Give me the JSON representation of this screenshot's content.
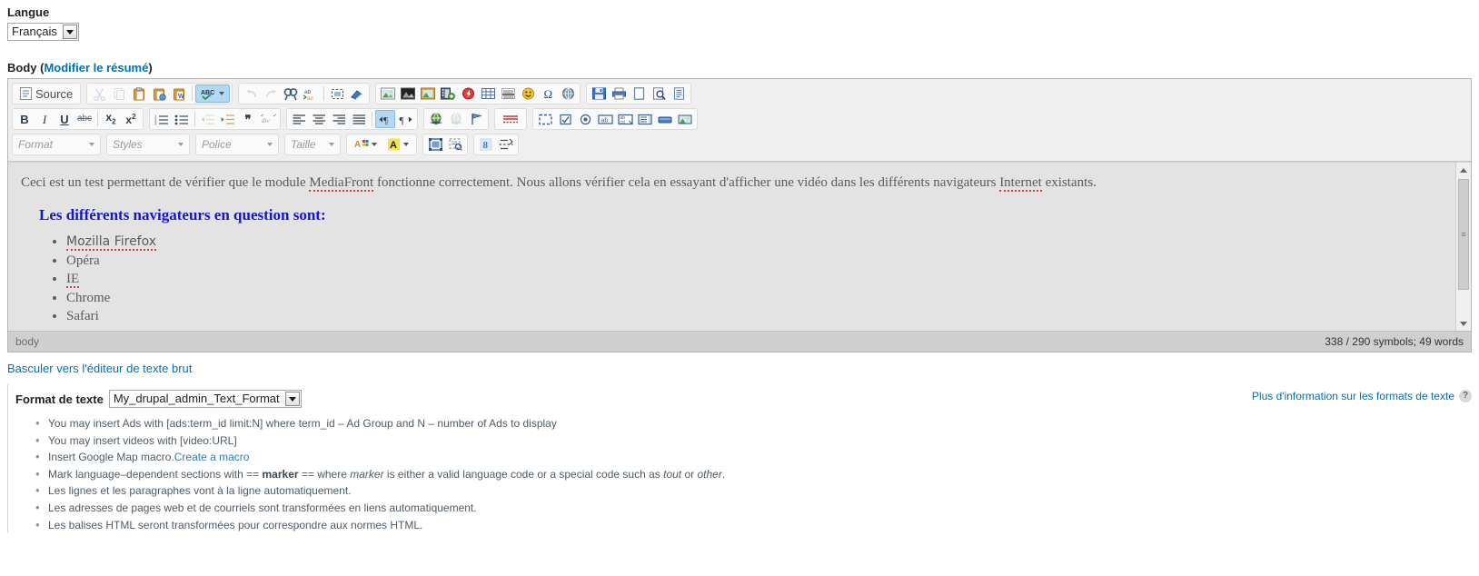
{
  "language_field": {
    "label": "Langue",
    "selected": "Français"
  },
  "body_field": {
    "label_prefix": "Body (",
    "summary_link": "Modifier le résumé",
    "label_suffix": ")"
  },
  "editor": {
    "toolbar_row1": {
      "source_label": "Source",
      "buttons": [
        {
          "name": "cut-icon",
          "glyph": "✂",
          "state": "disabled"
        },
        {
          "name": "copy-icon",
          "glyph": "❐",
          "state": "disabled"
        },
        {
          "name": "paste-icon",
          "glyph": "📋",
          "state": "normal"
        },
        {
          "name": "paste-as-plain-text-icon",
          "glyph": "📄",
          "state": "normal"
        },
        {
          "name": "paste-from-word-icon",
          "glyph": "W",
          "state": "normal"
        },
        {
          "name": "spell-check-icon",
          "glyph": "ABC",
          "state": "active"
        },
        {
          "name": "undo-icon",
          "glyph": "↶",
          "state": "disabled"
        },
        {
          "name": "redo-icon",
          "glyph": "↷",
          "state": "disabled"
        },
        {
          "name": "find-icon",
          "glyph": "🔍",
          "state": "normal"
        },
        {
          "name": "replace-icon",
          "glyph": "ab",
          "state": "normal"
        },
        {
          "name": "select-all-icon",
          "glyph": "⬚",
          "state": "normal"
        },
        {
          "name": "remove-format-icon",
          "glyph": "◆",
          "state": "normal"
        },
        {
          "name": "image-icon",
          "glyph": "🖼",
          "state": "normal"
        },
        {
          "name": "media-icon",
          "glyph": "🏞",
          "state": "normal"
        },
        {
          "name": "picture-frame-icon",
          "glyph": "▣",
          "state": "normal"
        },
        {
          "name": "add-video-icon",
          "glyph": "🎞",
          "state": "normal"
        },
        {
          "name": "flash-icon",
          "glyph": "ƒ",
          "state": "normal"
        },
        {
          "name": "table-icon",
          "glyph": "▦",
          "state": "normal"
        },
        {
          "name": "horizontal-rule-icon",
          "glyph": "▤",
          "state": "normal"
        },
        {
          "name": "smiley-icon",
          "glyph": "☺",
          "state": "normal"
        },
        {
          "name": "special-character-icon",
          "glyph": "Ω",
          "state": "normal"
        },
        {
          "name": "page-break-icon",
          "glyph": "◉",
          "state": "normal"
        },
        {
          "name": "save-icon",
          "glyph": "💾",
          "state": "normal"
        },
        {
          "name": "print-icon",
          "glyph": "🖨",
          "state": "normal"
        },
        {
          "name": "new-page-icon",
          "glyph": "▭",
          "state": "normal"
        },
        {
          "name": "preview-icon",
          "glyph": "🔎",
          "state": "normal"
        },
        {
          "name": "templates-icon",
          "glyph": "▤",
          "state": "normal"
        }
      ]
    },
    "toolbar_row2": {
      "buttons": [
        {
          "name": "bold-icon",
          "glyph": "B",
          "state": "normal"
        },
        {
          "name": "italic-icon",
          "glyph": "I",
          "state": "normal"
        },
        {
          "name": "underline-icon",
          "glyph": "U",
          "state": "normal"
        },
        {
          "name": "strikethrough-icon",
          "glyph": "abc",
          "state": "normal"
        },
        {
          "name": "subscript-icon",
          "glyph": "x₂",
          "state": "normal"
        },
        {
          "name": "superscript-icon",
          "glyph": "x²",
          "state": "normal"
        },
        {
          "name": "numbered-list-icon",
          "glyph": "1≡",
          "state": "normal"
        },
        {
          "name": "bulleted-list-icon",
          "glyph": "•≡",
          "state": "normal"
        },
        {
          "name": "decrease-indent-icon",
          "glyph": "⇤",
          "state": "disabled"
        },
        {
          "name": "increase-indent-icon",
          "glyph": "⇥",
          "state": "normal"
        },
        {
          "name": "blockquote-icon",
          "glyph": "❞",
          "state": "normal"
        },
        {
          "name": "create-div-icon",
          "glyph": "div",
          "state": "normal"
        },
        {
          "name": "align-left-icon",
          "glyph": "≡",
          "state": "normal"
        },
        {
          "name": "align-center-icon",
          "glyph": "≡",
          "state": "normal"
        },
        {
          "name": "align-right-icon",
          "glyph": "≡",
          "state": "normal"
        },
        {
          "name": "justify-icon",
          "glyph": "≡",
          "state": "normal"
        },
        {
          "name": "text-direction-ltr-icon",
          "glyph": "¶",
          "state": "active"
        },
        {
          "name": "text-direction-rtl-icon",
          "glyph": "¶",
          "state": "normal"
        },
        {
          "name": "link-icon",
          "glyph": "🌐",
          "state": "normal"
        },
        {
          "name": "unlink-icon",
          "glyph": "🌐",
          "state": "disabled"
        },
        {
          "name": "anchor-icon",
          "glyph": "⚑",
          "state": "normal"
        },
        {
          "name": "spell-underline-icon",
          "glyph": "≣",
          "state": "normal"
        },
        {
          "name": "show-blocks-icon",
          "glyph": "⬚",
          "state": "normal"
        },
        {
          "name": "checkbox-icon",
          "glyph": "☑",
          "state": "normal"
        },
        {
          "name": "radio-button-icon",
          "glyph": "◉",
          "state": "normal"
        },
        {
          "name": "text-field-icon",
          "glyph": "ab",
          "state": "normal"
        },
        {
          "name": "textarea-icon",
          "glyph": "abcd",
          "state": "normal"
        },
        {
          "name": "selection-field-icon",
          "glyph": "▤",
          "state": "normal"
        },
        {
          "name": "button-icon",
          "glyph": "▬",
          "state": "normal"
        },
        {
          "name": "image-button-icon",
          "glyph": "🖼",
          "state": "normal"
        }
      ]
    },
    "toolbar_row3": {
      "combos": [
        {
          "name": "format-combo",
          "label": "Format"
        },
        {
          "name": "styles-combo",
          "label": "Styles"
        },
        {
          "name": "font-combo",
          "label": "Police"
        },
        {
          "name": "size-combo",
          "label": "Taille"
        }
      ],
      "buttons": [
        {
          "name": "text-color-icon",
          "glyph": "A",
          "state": "normal"
        },
        {
          "name": "background-color-icon",
          "glyph": "A",
          "state": "normal"
        },
        {
          "name": "maximize-icon",
          "glyph": "⛶",
          "state": "normal"
        },
        {
          "name": "show-blocks-icon",
          "glyph": "▣",
          "state": "normal"
        },
        {
          "name": "drupal-break-icon",
          "glyph": "8",
          "state": "normal"
        },
        {
          "name": "page-break-icon",
          "glyph": "⇹",
          "state": "normal"
        }
      ]
    },
    "document": {
      "paragraph_part1": "Ceci est un test permettant de vérifier que le module ",
      "paragraph_misspelled1": "MediaFront",
      "paragraph_part2": " fonctionne correctement. Nous allons vérifier cela en essayant d'afficher une vidéo dans les différents navigateurs ",
      "paragraph_misspelled2": "Internet",
      "paragraph_part3": " existants.",
      "heading": "Les différents navigateurs en question sont:",
      "list_items": [
        "Mozilla Firefox",
        "Opéra",
        "IE",
        "Chrome",
        "Safari"
      ]
    },
    "status": {
      "element_path": "body",
      "counter": "338 / 290 symbols; 49 words"
    }
  },
  "switch_editor_link": "Basculer vers l'éditeur de texte brut",
  "text_format": {
    "label": "Format de texte",
    "selected": "My_drupal_admin_Text_Format",
    "help_link": "Plus d'information sur les formats de texte",
    "help_icon": "?"
  },
  "format_tips": [
    {
      "parts": [
        {
          "t": "text",
          "v": "You may insert Ads with [ads:term_id limit:N] where term_id – Ad Group and N – number of Ads to display"
        }
      ]
    },
    {
      "parts": [
        {
          "t": "text",
          "v": "You may insert videos with [video:URL]"
        }
      ]
    },
    {
      "parts": [
        {
          "t": "text",
          "v": "Insert Google Map macro."
        },
        {
          "t": "link",
          "v": "Create a macro"
        }
      ]
    },
    {
      "parts": [
        {
          "t": "text",
          "v": "Mark language–dependent sections with == "
        },
        {
          "t": "bold",
          "v": "marker"
        },
        {
          "t": "text",
          "v": " == where "
        },
        {
          "t": "italic",
          "v": "marker"
        },
        {
          "t": "text",
          "v": " is either a valid language code or a special code such as "
        },
        {
          "t": "italic",
          "v": "tout"
        },
        {
          "t": "text",
          "v": " or "
        },
        {
          "t": "italic",
          "v": "other"
        },
        {
          "t": "text",
          "v": "."
        }
      ]
    },
    {
      "parts": [
        {
          "t": "text",
          "v": "Les lignes et les paragraphes vont à la ligne automatiquement."
        }
      ]
    },
    {
      "parts": [
        {
          "t": "text",
          "v": "Les adresses de pages web et de courriels sont transformées en liens automatiquement."
        }
      ]
    },
    {
      "parts": [
        {
          "t": "text",
          "v": "Les balises HTML seront transformées pour correspondre aux normes HTML."
        }
      ]
    }
  ],
  "colors": {
    "link": "#0071b3",
    "heading_blue": "#1414d2",
    "toolbar_bg": "#efefef",
    "editor_bg": "#e3e3e3",
    "active_button": "#b3d8f5"
  }
}
